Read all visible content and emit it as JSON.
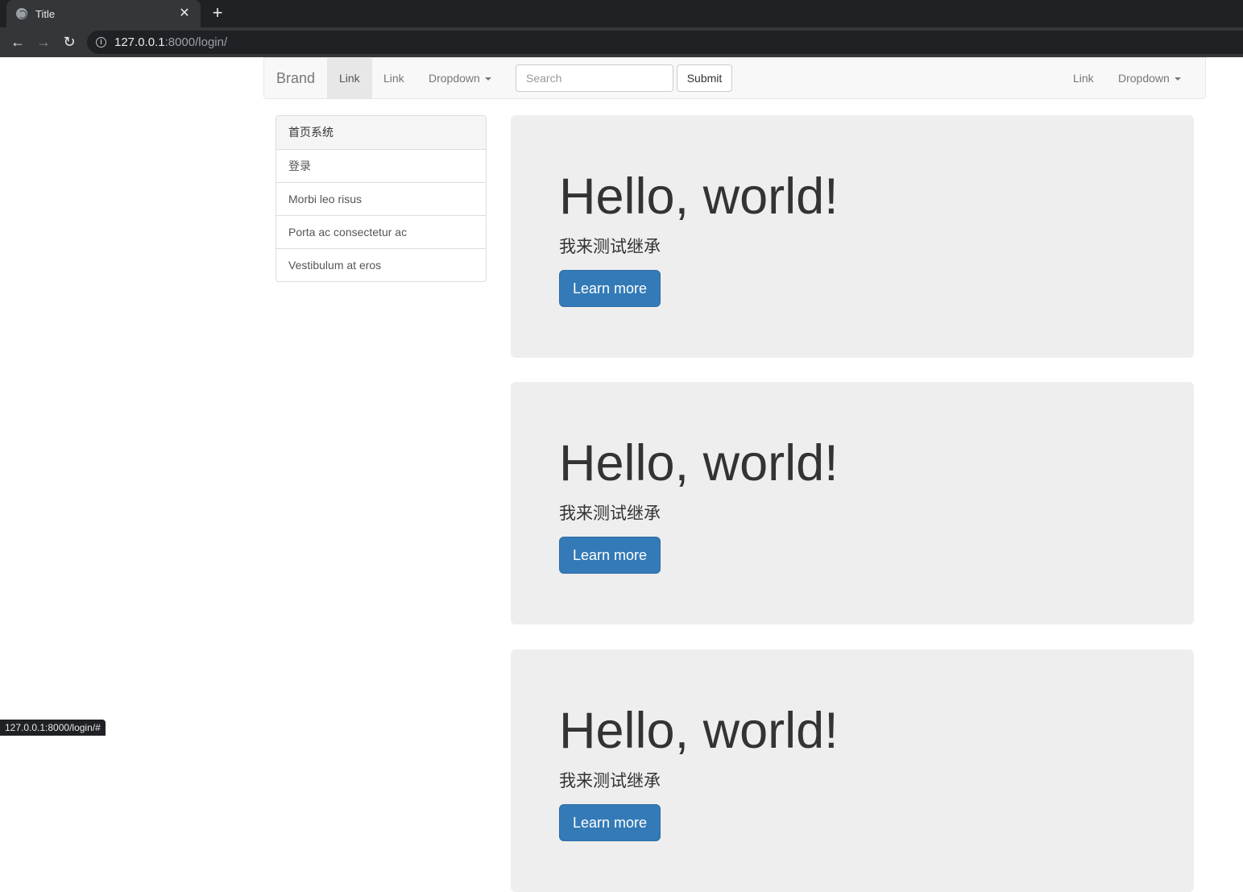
{
  "browser": {
    "tab_title": "Title",
    "tab_close": "✕",
    "new_tab": "+",
    "back": "←",
    "forward": "→",
    "reload": "↻",
    "url_host": "127.0.0.1",
    "url_rest": ":8000/login/",
    "status_url": "127.0.0.1:8000/login/#"
  },
  "navbar": {
    "brand": "Brand",
    "links_left": [
      "Link",
      "Link"
    ],
    "dropdown_left": "Dropdown",
    "search_placeholder": "Search",
    "submit": "Submit",
    "link_right": "Link",
    "dropdown_right": "Dropdown"
  },
  "sidebar": {
    "items": [
      "首页系统",
      "登录",
      "Morbi leo risus",
      "Porta ac consectetur ac",
      "Vestibulum at eros"
    ]
  },
  "jumbotrons": [
    {
      "title": "Hello, world!",
      "text": "我来测试继承",
      "button": "Learn more"
    },
    {
      "title": "Hello, world!",
      "text": "我来测试继承",
      "button": "Learn more"
    },
    {
      "title": "Hello, world!",
      "text": "我来测试继承",
      "button": "Learn more"
    }
  ],
  "colors": {
    "primary_button": "#337ab7",
    "jumbotron_bg": "#eeeeee",
    "navbar_bg": "#f8f8f8"
  }
}
